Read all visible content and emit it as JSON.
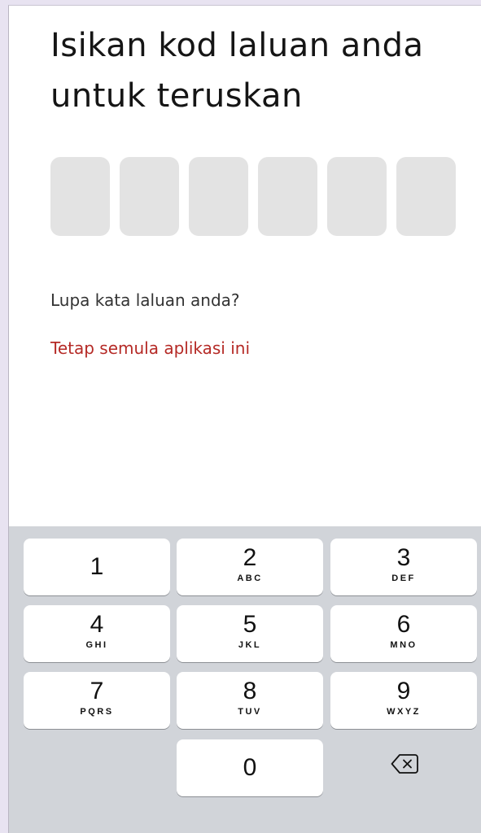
{
  "title": "Isikan kod laluan anda untuk teruskan",
  "pin": {
    "digits_entered": 0,
    "length": 6
  },
  "forgot_text": "Lupa kata laluan anda?",
  "reset_link": "Tetap semula aplikasi ini",
  "keypad": {
    "keys": [
      {
        "digit": "1",
        "letters": ""
      },
      {
        "digit": "2",
        "letters": "ABC"
      },
      {
        "digit": "3",
        "letters": "DEF"
      },
      {
        "digit": "4",
        "letters": "GHI"
      },
      {
        "digit": "5",
        "letters": "JKL"
      },
      {
        "digit": "6",
        "letters": "MNO"
      },
      {
        "digit": "7",
        "letters": "PQRS"
      },
      {
        "digit": "8",
        "letters": "TUV"
      },
      {
        "digit": "9",
        "letters": "WXYZ"
      },
      {
        "digit": "0",
        "letters": ""
      }
    ],
    "backspace_icon": "backspace-icon"
  },
  "colors": {
    "accent": "#b52a26",
    "pin_box": "#e3e3e3",
    "keypad_bg": "#d1d4d9"
  }
}
